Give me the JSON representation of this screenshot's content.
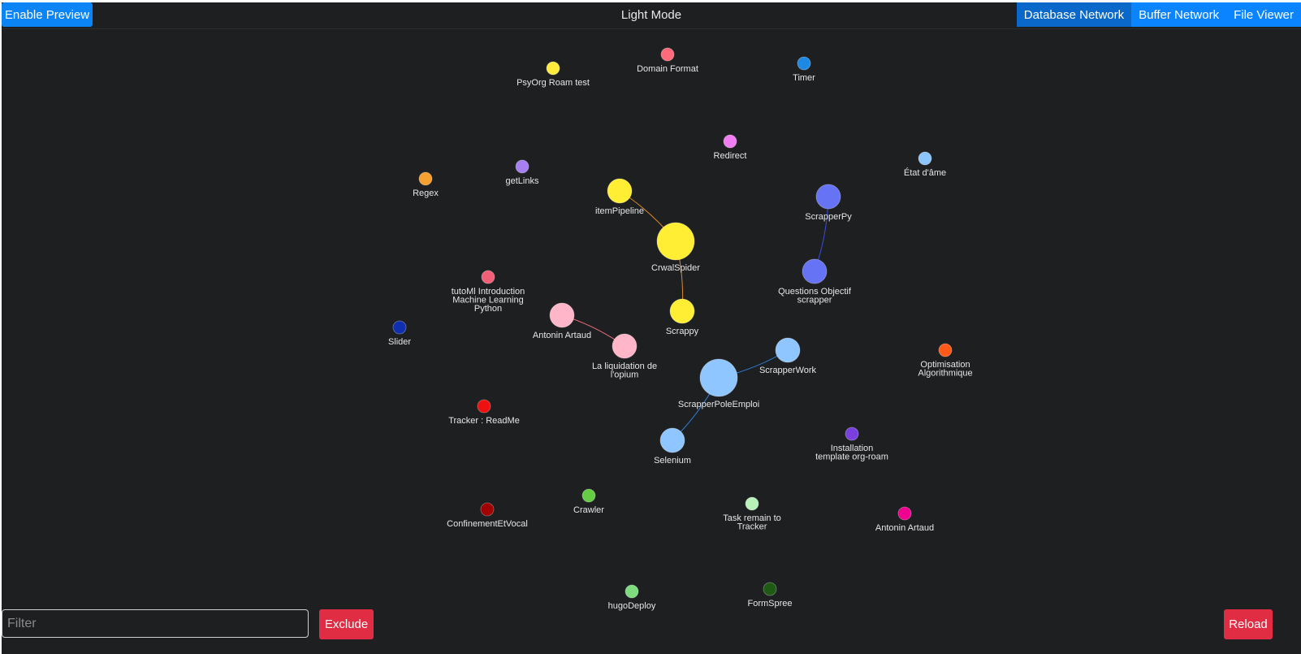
{
  "header": {
    "enable_preview_label": "Enable Preview",
    "mode_label": "Light Mode",
    "tabs": [
      {
        "label": "Database Network",
        "active": true
      },
      {
        "label": "Buffer Network",
        "active": false
      },
      {
        "label": "File Viewer",
        "active": false
      }
    ]
  },
  "graph": {
    "nodes": [
      {
        "id": "psyorg",
        "lines": [
          "PsyOrg Roam test"
        ],
        "color": "#ffeb3b"
      },
      {
        "id": "domainformat",
        "lines": [
          "Domain Format"
        ],
        "color": "#ff6b7a"
      },
      {
        "id": "timer",
        "lines": [
          "Timer"
        ],
        "color": "#1e88e5"
      },
      {
        "id": "redirect",
        "lines": [
          "Redirect"
        ],
        "color": "#f27df2"
      },
      {
        "id": "etatdame",
        "lines": [
          "État d'âme"
        ],
        "color": "#8cc6ff"
      },
      {
        "id": "regex",
        "lines": [
          "Regex"
        ],
        "color": "#f5a030"
      },
      {
        "id": "getlinks",
        "lines": [
          "getLinks"
        ],
        "color": "#a77ff0"
      },
      {
        "id": "itempipeline",
        "lines": [
          "itemPipeline"
        ],
        "color": "#ffee33"
      },
      {
        "id": "scrapperpy",
        "lines": [
          "ScrapperPy"
        ],
        "color": "#6673f5"
      },
      {
        "id": "crwalspider",
        "lines": [
          "CrwalSpider"
        ],
        "color": "#ffee33"
      },
      {
        "id": "questions",
        "lines": [
          "Questions Objectif",
          "scrapper"
        ],
        "color": "#6673f5"
      },
      {
        "id": "tutoml",
        "lines": [
          "tutoMl Introduction",
          "Machine Learning",
          "Python"
        ],
        "color": "#f26078"
      },
      {
        "id": "antonin1",
        "lines": [
          "Antonin Artaud"
        ],
        "color": "#ffb6c8"
      },
      {
        "id": "scrappy",
        "lines": [
          "Scrappy"
        ],
        "color": "#ffee33"
      },
      {
        "id": "slider",
        "lines": [
          "Slider"
        ],
        "color": "#0f2fb0"
      },
      {
        "id": "liquidation",
        "lines": [
          "La liquidation de",
          "l'opium"
        ],
        "color": "#ffb6c8"
      },
      {
        "id": "scrapperwork",
        "lines": [
          "ScrapperWork"
        ],
        "color": "#90c6ff"
      },
      {
        "id": "optimisation",
        "lines": [
          "Optimisation",
          "Algorithmique"
        ],
        "color": "#ff5a1a"
      },
      {
        "id": "scrapperpole",
        "lines": [
          "ScrapperPoleEmploi"
        ],
        "color": "#90c6ff"
      },
      {
        "id": "tracker",
        "lines": [
          "Tracker : ReadMe"
        ],
        "color": "#f01010"
      },
      {
        "id": "installation",
        "lines": [
          "Installation",
          "template org-roam"
        ],
        "color": "#7a3fe0"
      },
      {
        "id": "selenium",
        "lines": [
          "Selenium"
        ],
        "color": "#90c6ff"
      },
      {
        "id": "crawler",
        "lines": [
          "Crawler"
        ],
        "color": "#66cc44"
      },
      {
        "id": "task",
        "lines": [
          "Task remain to",
          "Tracker"
        ],
        "color": "#b8f2b8"
      },
      {
        "id": "confinement",
        "lines": [
          "ConfinementEtVocal"
        ],
        "color": "#a00000"
      },
      {
        "id": "antonin2",
        "lines": [
          "Antonin Artaud"
        ],
        "color": "#f00090"
      },
      {
        "id": "hugodeploy",
        "lines": [
          "hugoDeploy"
        ],
        "color": "#7ddc7d"
      },
      {
        "id": "formspree",
        "lines": [
          "FormSpree"
        ],
        "color": "#1e5a14"
      }
    ],
    "links": [
      {
        "source": "itempipeline",
        "target": "crwalspider",
        "color": "#d98a2a"
      },
      {
        "source": "crwalspider",
        "target": "scrappy",
        "color": "#d98a2a"
      },
      {
        "source": "scrapperpy",
        "target": "questions",
        "color": "#3a4ad8"
      },
      {
        "source": "antonin1",
        "target": "liquidation",
        "color": "#e06a7a"
      },
      {
        "source": "scrapperwork",
        "target": "scrapperpole",
        "color": "#2f7fd8"
      },
      {
        "source": "scrapperpole",
        "target": "selenium",
        "color": "#2f7fd8"
      }
    ]
  },
  "footer": {
    "filter_placeholder": "Filter",
    "filter_value": "",
    "exclude_label": "Exclude",
    "reload_label": "Reload"
  }
}
